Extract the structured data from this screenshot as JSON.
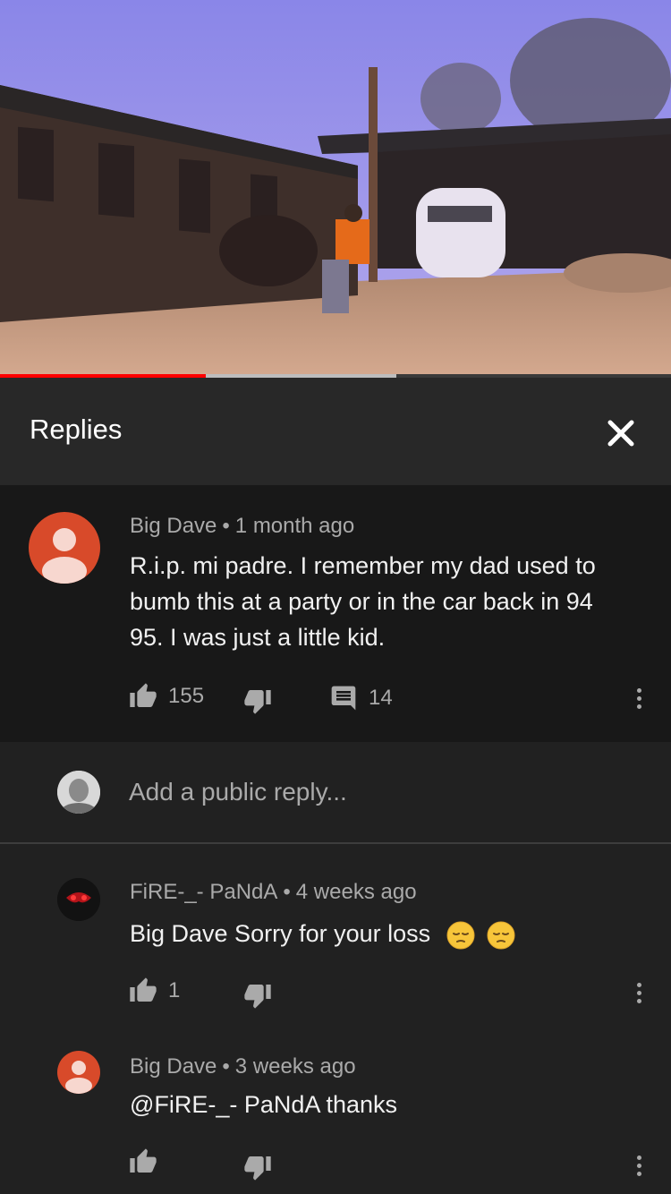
{
  "video": {
    "progress_played": 0.307,
    "progress_buffered": 0.59
  },
  "replies_panel": {
    "title": "Replies"
  },
  "parent_comment": {
    "author": "Big Dave",
    "separator": "•",
    "time": "1 month ago",
    "text": "R.i.p. mi padre. I remember my dad used to bumb this at a party or in the car back in 94 95. I was just a little kid.",
    "likes": "155",
    "replies_count": "14",
    "avatar_color": "#d84a2a"
  },
  "add_reply": {
    "placeholder": "Add a public reply..."
  },
  "replies": [
    {
      "author": "FiRE-_- PaNdA",
      "separator": "•",
      "time": "4 weeks ago",
      "text": "Big Dave Sorry for your loss",
      "emojis": [
        "pensive-face",
        "pensive-face"
      ],
      "likes": "1"
    },
    {
      "author": "Big Dave",
      "separator": "•",
      "time": "3 weeks ago",
      "text": "@FiRE-_- PaNdA thanks",
      "likes": "",
      "avatar_color": "#d84a2a"
    }
  ],
  "colors": {
    "background": "#212121",
    "header_bg": "#282828",
    "parent_bg": "#181818",
    "progress_red": "#ff0000",
    "secondary_text": "#aaaaaa"
  }
}
